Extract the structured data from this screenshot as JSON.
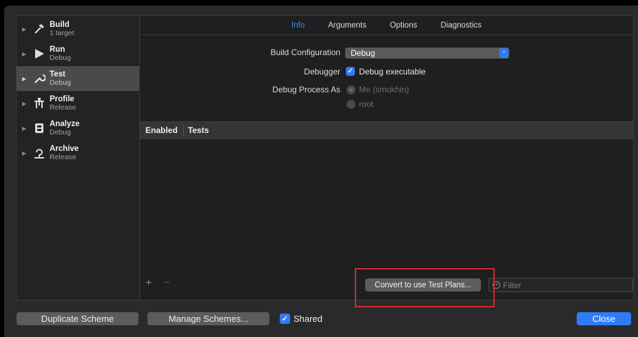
{
  "sidebar": {
    "items": [
      {
        "title": "Build",
        "subtitle": "1 target",
        "icon": "hammer-icon"
      },
      {
        "title": "Run",
        "subtitle": "Debug",
        "icon": "play-icon"
      },
      {
        "title": "Test",
        "subtitle": "Debug",
        "icon": "wrench-icon",
        "selected": true
      },
      {
        "title": "Profile",
        "subtitle": "Release",
        "icon": "profile-icon"
      },
      {
        "title": "Analyze",
        "subtitle": "Debug",
        "icon": "analyze-icon"
      },
      {
        "title": "Archive",
        "subtitle": "Release",
        "icon": "archive-icon"
      }
    ]
  },
  "tabs": [
    "Info",
    "Arguments",
    "Options",
    "Diagnostics"
  ],
  "active_tab": "Info",
  "form": {
    "build_config_label": "Build Configuration",
    "build_config_value": "Debug",
    "debugger_label": "Debugger",
    "debugger_option": "Debug executable",
    "debug_process_label": "Debug Process As",
    "process_option_me": "Me (smokhin)",
    "process_option_root": "root"
  },
  "table": {
    "col_enabled": "Enabled",
    "col_tests": "Tests"
  },
  "bottom": {
    "plus": "+",
    "minus": "−",
    "convert_label": "Convert to use Test Plans...",
    "filter_placeholder": "Filter"
  },
  "footer": {
    "duplicate_label": "Duplicate Scheme",
    "manage_label": "Manage Schemes...",
    "shared_label": "Shared",
    "close_label": "Close"
  },
  "colors": {
    "accent": "#2f7cf6",
    "active_tab": "#3a8ff3",
    "highlight": "#d42a2a"
  }
}
